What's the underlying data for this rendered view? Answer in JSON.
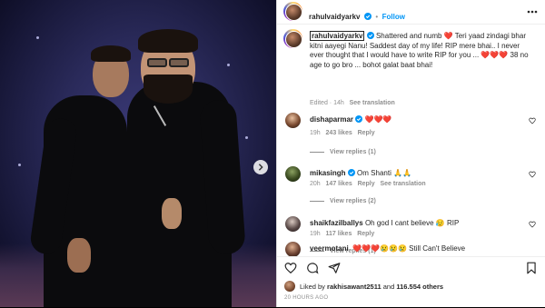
{
  "post": {
    "username": "rahulvaidyarkv",
    "follow_label": "Follow",
    "separator": "•"
  },
  "caption": {
    "username": "rahulvaidyarkv",
    "text": "Shattered and numb ❤️ Teri yaad zindagi bhar kitni aayegi Nanu! Saddest day of my life! RIP mere bhai.. I never ever thought that I would have to write RIP for you ... ❤️❤️❤️ 38 no age to go bro ... bohot galat baat bhai!",
    "edited": "Edited · 14h",
    "see_translation": "See translation"
  },
  "comments": [
    {
      "username": "dishaparmar",
      "text": "❤️❤️❤️",
      "time": "19h",
      "likes": "243 likes",
      "reply": "Reply",
      "view_replies": "View replies (1)"
    },
    {
      "username": "mikasingh",
      "text": "Om Shanti 🙏🙏",
      "time": "20h",
      "likes": "147 likes",
      "reply": "Reply",
      "see_translation": "See translation",
      "view_replies": "View replies (2)"
    },
    {
      "username": "shaikfazilballys",
      "text": "Oh god I cant believe 😥 RIP",
      "time": "19h",
      "likes": "117 likes",
      "reply": "Reply",
      "view_replies": "View replies (1)"
    },
    {
      "username": "veermotani",
      "text": "❤️❤️❤️😢😢😢 Still Can't Believe"
    }
  ],
  "liked_by": {
    "prefix": "Liked by",
    "user": "rakhisawant2511",
    "mid": "and",
    "count": "116.554 others"
  },
  "timestamp": "20 HOURS AGO",
  "colors": {
    "accent": "#0095f6",
    "heart": "#ed4956",
    "text": "#262626",
    "muted": "#8e8e8e"
  },
  "icons": [
    "heart-icon",
    "comment-icon",
    "share-icon",
    "bookmark-icon",
    "verified-icon",
    "more-icon",
    "chevron-right-icon"
  ]
}
